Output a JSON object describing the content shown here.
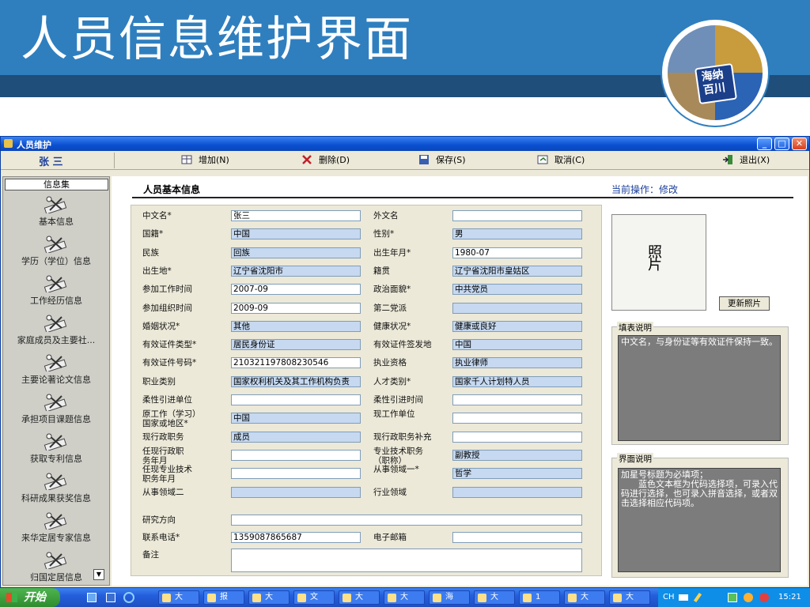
{
  "slide": {
    "title": "人员信息维护界面",
    "logo_text": "海纳百川"
  },
  "window": {
    "title": "人员维护",
    "buttons": {
      "minimize": "_",
      "maximize": "□",
      "close": "✕"
    }
  },
  "toolbar": {
    "username": "张 三",
    "add_label": "增加(N)",
    "delete_label": "删除(D)",
    "save_label": "保存(S)",
    "cancel_label": "取消(C)",
    "exit_label": "退出(X)"
  },
  "sidebar": {
    "header": "信息集",
    "items": [
      {
        "label": "基本信息"
      },
      {
        "label": "学历（学位）信息"
      },
      {
        "label": "工作经历信息"
      },
      {
        "label": "家庭成员及主要社..."
      },
      {
        "label": "主要论著论文信息"
      },
      {
        "label": "承担项目课题信息"
      },
      {
        "label": "获取专利信息"
      },
      {
        "label": "科研成果获奖信息"
      },
      {
        "label": "来华定居专家信息"
      },
      {
        "label": "归国定居信息"
      }
    ]
  },
  "main": {
    "section_title": "人员基本信息",
    "current_op": "当前操作：修改"
  },
  "form": {
    "rows": [
      {
        "l1": "中文名*",
        "v1": "张三",
        "r1": false,
        "l2": "外文名",
        "v2": "",
        "r2": false
      },
      {
        "l1": "国籍*",
        "v1": "中国",
        "r1": true,
        "l2": "性别*",
        "v2": "男",
        "r2": true
      },
      {
        "l1": "民族",
        "v1": "回族",
        "r1": true,
        "l2": "出生年月*",
        "v2": "1980-07",
        "r2": false
      },
      {
        "l1": "出生地*",
        "v1": "辽宁省沈阳市",
        "r1": true,
        "l2": "籍贯",
        "v2": "辽宁省沈阳市皇姑区",
        "r2": true
      },
      {
        "l1": "参加工作时间",
        "v1": "2007-09",
        "r1": false,
        "l2": "政治面貌*",
        "v2": "中共党员",
        "r2": true
      },
      {
        "l1": "参加组织时间",
        "v1": "2009-09",
        "r1": false,
        "l2": "第二党派",
        "v2": "",
        "r2": true
      },
      {
        "l1": "婚姻状况*",
        "v1": "其他",
        "r1": true,
        "l2": "健康状况*",
        "v2": "健康或良好",
        "r2": true
      },
      {
        "l1": "有效证件类型*",
        "v1": "居民身份证",
        "r1": true,
        "l2": "有效证件签发地",
        "v2": "中国",
        "r2": true
      },
      {
        "l1": "有效证件号码*",
        "v1": "210321197808230546",
        "r1": false,
        "l2": "执业资格",
        "v2": "执业律师",
        "r2": true
      },
      {
        "l1": "职业类别",
        "v1": "国家权利机关及其工作机构负责",
        "r1": true,
        "l2": "人才类别*",
        "v2": "国家千人计划特人员",
        "r2": true
      },
      {
        "l1": "柔性引进单位",
        "v1": "",
        "r1": false,
        "l2": "柔性引进时间",
        "v2": "",
        "r2": false
      },
      {
        "l1": "原工作（学习）\n国家或地区*",
        "v1": "中国",
        "r1": true,
        "l2": "现工作单位",
        "v2": "",
        "r2": false
      },
      {
        "l1": "现行政职务",
        "v1": "成员",
        "r1": true,
        "l2": "现行政职务补充",
        "v2": "",
        "r2": false
      },
      {
        "l1": "任现行政职\n务年月",
        "v1": "",
        "r1": false,
        "l2": "专业技术职务\n（职称）",
        "v2": "副教授",
        "r2": true
      },
      {
        "l1": "任现专业技术\n职务年月",
        "v1": "",
        "r1": false,
        "l2": "从事领域一*",
        "v2": "哲学",
        "r2": true
      },
      {
        "l1": "从事领域二",
        "v1": "",
        "r1": true,
        "l2": "行业领域",
        "v2": "",
        "r2": true
      }
    ],
    "research_label": "研究方向",
    "research_value": "",
    "phone_label": "联系电话*",
    "phone_value": "13590878656​87",
    "email_label": "电子邮箱",
    "email_value": "",
    "remark_label": "备注",
    "remark_value": ""
  },
  "photo": {
    "placeholder": "照片",
    "update_button": "更新照片"
  },
  "fill_note": {
    "title": "填表说明",
    "text": "中文名，与身份证等有效证件保持一致。"
  },
  "ui_note": {
    "title": "界面说明",
    "text": "加星号标题为必填项；\n　　蓝色文本框为代码选择项，可录入代码进行选择，也可录入拼音选择，或者双击选择相应代码项。"
  },
  "taskbar": {
    "start_label": "开始",
    "tasks": [
      "大",
      "报",
      "大",
      "文",
      "大",
      "大",
      "海",
      "大",
      "1",
      "大",
      "大"
    ],
    "ime": "CH",
    "clock": "15:21"
  },
  "colors": {
    "accent": "#0a4fd0",
    "required_field": "#c6d9f1",
    "banner": "#2f7fbf"
  }
}
